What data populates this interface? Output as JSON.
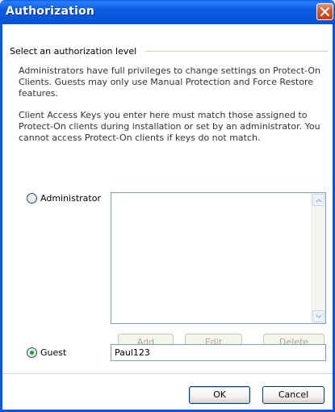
{
  "window": {
    "title": "Authorization",
    "close_icon": "close-icon"
  },
  "group": {
    "label": "Select an authorization level"
  },
  "description": {
    "para1": "Administrators have full privileges to change settings on Protect-On Clients. Guests may only use Manual Protection and Force Restore features.",
    "para2": "Client Access Keys you enter here must match those assigned to Protect-On clients during installation or set by an administrator. You cannot access Protect-On clients if keys do not match."
  },
  "administrator": {
    "label": "Administrator",
    "selected": false,
    "keys": [],
    "buttons": {
      "add": "Add",
      "edit": "Edit",
      "delete": "Delete"
    }
  },
  "guest": {
    "label": "Guest",
    "selected": true,
    "key_value": "Paul123"
  },
  "dialog_buttons": {
    "ok": "OK",
    "cancel": "Cancel"
  }
}
